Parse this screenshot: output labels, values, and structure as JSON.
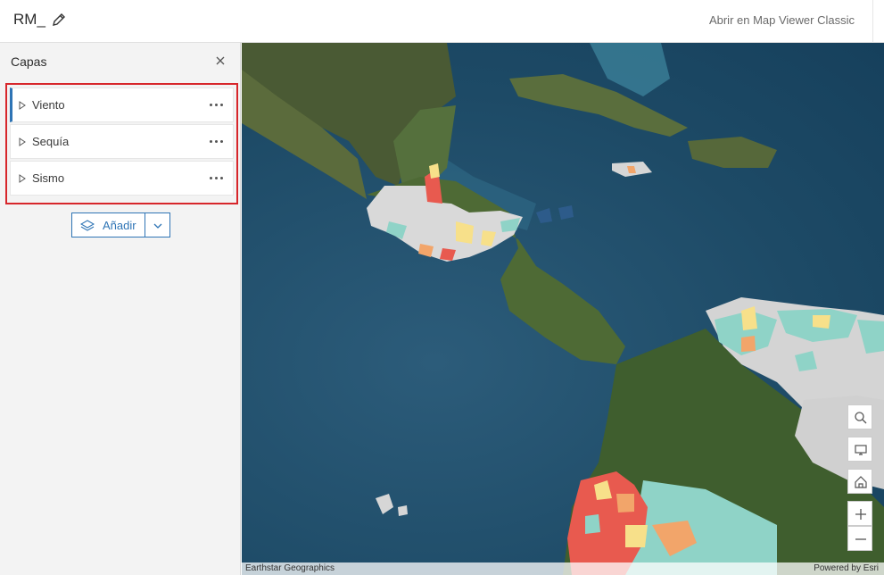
{
  "header": {
    "title": "RM_",
    "open_classic_label": "Abrir en Map Viewer Classic"
  },
  "layers_panel": {
    "title": "Capas",
    "layers": [
      {
        "label": "Viento",
        "active": true
      },
      {
        "label": "Sequía",
        "active": false
      },
      {
        "label": "Sismo",
        "active": false
      }
    ],
    "add_label": "Añadir"
  },
  "map": {
    "attribution_left": "Earthstar Geographics",
    "attribution_right": "Powered by Esri",
    "tools": [
      "search-icon",
      "monitor-icon",
      "home-icon",
      "zoom-in-icon",
      "zoom-out-icon"
    ]
  },
  "colors": {
    "accent": "#2e74b5",
    "highlight": "#d7262b"
  }
}
